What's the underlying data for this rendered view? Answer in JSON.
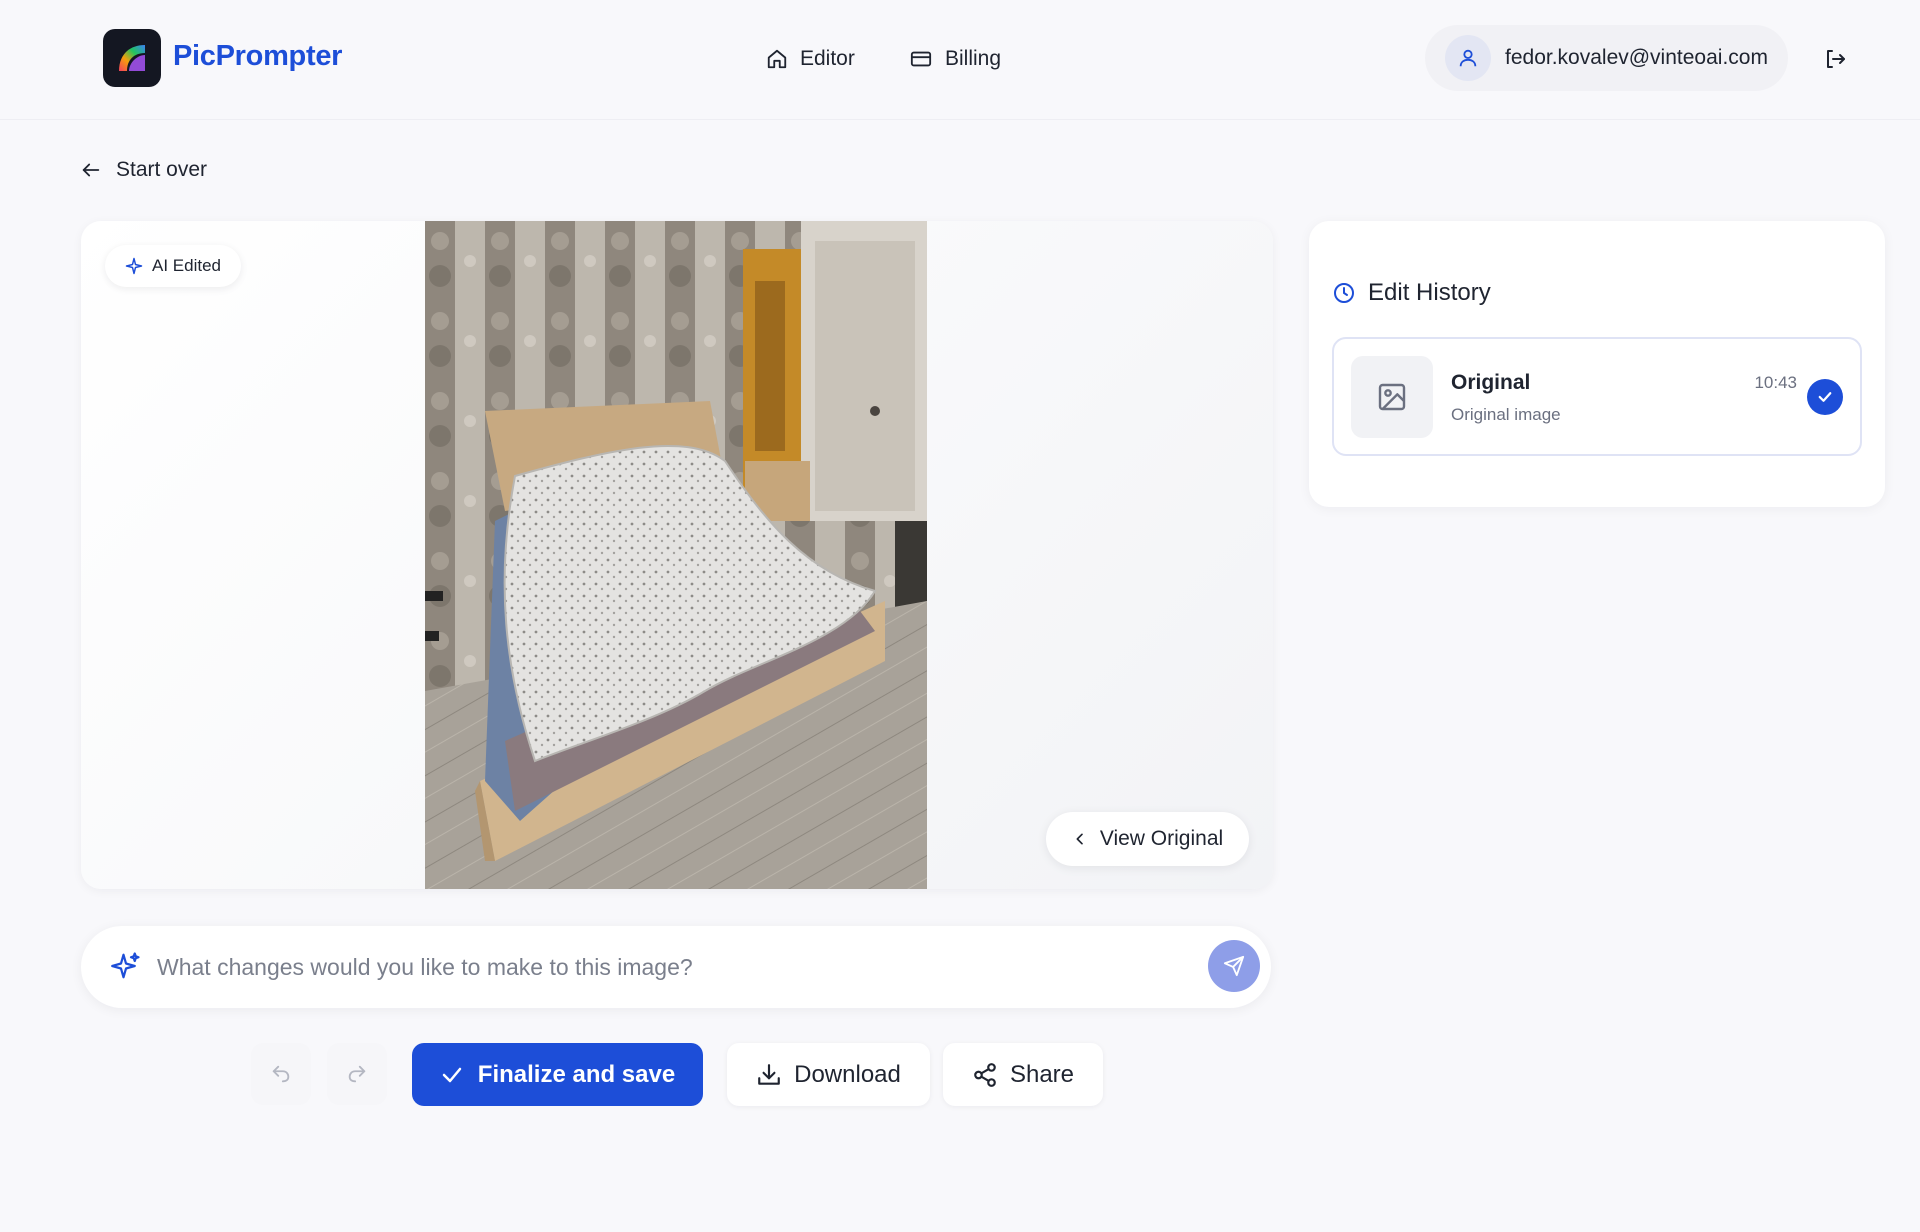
{
  "header": {
    "brand": "PicPrompter",
    "nav": [
      {
        "label": "Editor",
        "icon": "home-icon"
      },
      {
        "label": "Billing",
        "icon": "credit-card-icon"
      }
    ],
    "user_email": "fedor.kovalev@vinteoai.com"
  },
  "start_over_label": "Start over",
  "canvas": {
    "badge_label": "AI Edited",
    "view_original_label": "View Original"
  },
  "prompt": {
    "placeholder": "What changes would you like to make to this image?",
    "value": ""
  },
  "actions": {
    "finalize_label": "Finalize and save",
    "download_label": "Download",
    "share_label": "Share"
  },
  "history": {
    "title": "Edit History",
    "items": [
      {
        "name": "Original",
        "subtitle": "Original image",
        "time": "10:43",
        "selected": true
      }
    ]
  },
  "colors": {
    "accent": "#1d4ed8",
    "send_button": "#8e9ee8",
    "background": "#f8f8fb"
  }
}
